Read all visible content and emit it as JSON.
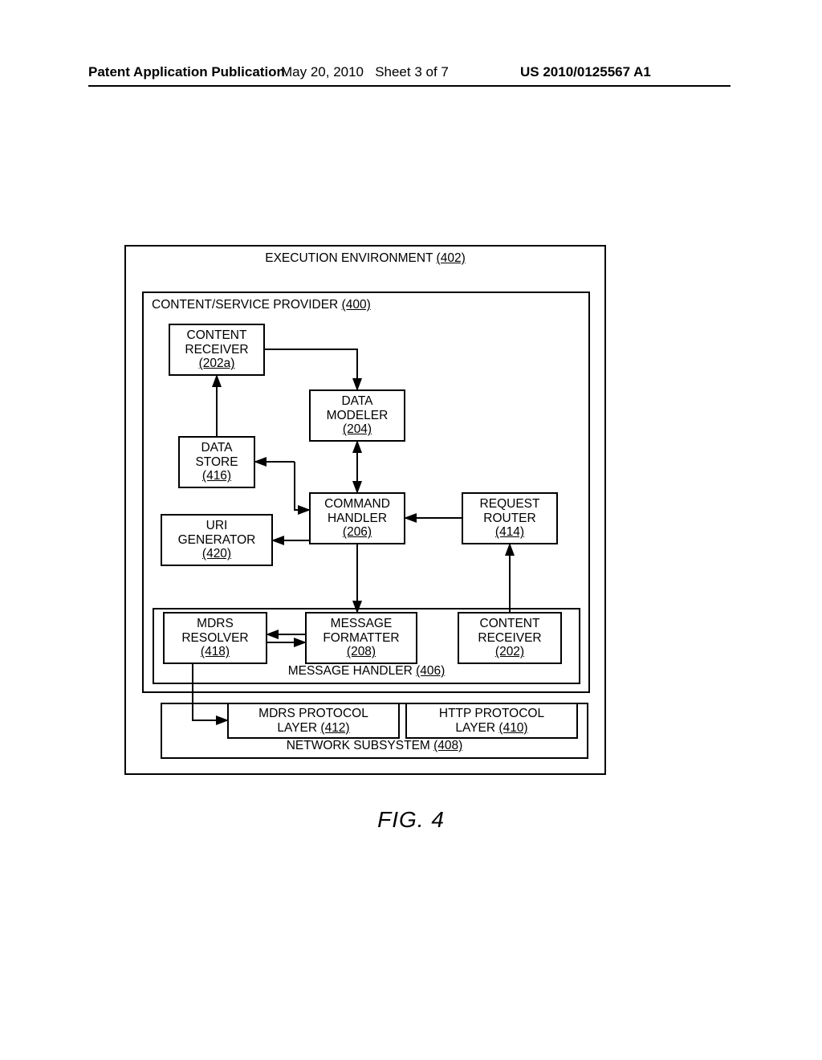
{
  "header": {
    "left": "Patent Application Publication",
    "mid_date": "May 20, 2010",
    "mid_sheet": "Sheet 3 of 7",
    "right": "US 2010/0125567 A1"
  },
  "labels": {
    "exec_env_text": "EXECUTION ENVIRONMENT ",
    "exec_env_ref": "(402)",
    "csp_text": "CONTENT/SERVICE PROVIDER ",
    "csp_ref": "(400)",
    "msg_handler_text": "MESSAGE HANDLER ",
    "msg_handler_ref": "(406)",
    "net_sub_text": "NETWORK SUBSYSTEM ",
    "net_sub_ref": "(408)"
  },
  "boxes": {
    "content_receiver_a": {
      "l1": "CONTENT",
      "l2": "RECEIVER",
      "ref": "(202a)"
    },
    "data_modeler": {
      "l1": "DATA",
      "l2": "MODELER",
      "ref": "(204)"
    },
    "data_store": {
      "l1": "DATA",
      "l2": "STORE",
      "ref": "(416)"
    },
    "uri_generator": {
      "l1": "URI",
      "l2": "GENERATOR",
      "ref": "(420)"
    },
    "command_handler": {
      "l1": "COMMAND",
      "l2": "HANDLER",
      "ref": "(206)"
    },
    "request_router": {
      "l1": "REQUEST",
      "l2": "ROUTER",
      "ref": "(414)"
    },
    "mdrs_resolver": {
      "l1": "MDRS",
      "l2": "RESOLVER",
      "ref": "(418)"
    },
    "message_formatter": {
      "l1": "MESSAGE",
      "l2": "FORMATTER",
      "ref": "(208)"
    },
    "content_receiver": {
      "l1": "CONTENT",
      "l2": "RECEIVER",
      "ref": "(202)"
    },
    "mdrs_layer": {
      "l1": "MDRS PROTOCOL",
      "l2a": "LAYER ",
      "ref": "(412)"
    },
    "http_layer": {
      "l1": "HTTP PROTOCOL",
      "l2a": "LAYER ",
      "ref": "(410)"
    }
  },
  "figure": "FIG. 4"
}
